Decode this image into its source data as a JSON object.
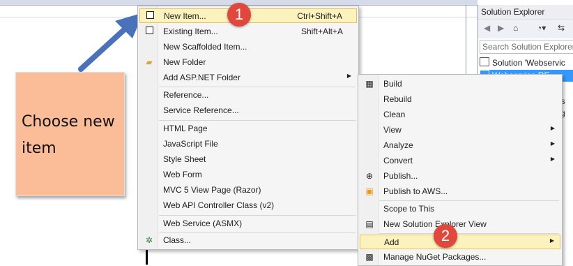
{
  "callout": {
    "text": "Choose new item"
  },
  "add_menu": {
    "items": [
      {
        "label": "New Item...",
        "shortcut": "Ctrl+Shift+A"
      },
      {
        "label": "Existing Item...",
        "shortcut": "Shift+Alt+A"
      },
      {
        "label": "New Scaffolded Item..."
      },
      {
        "label": "New Folder"
      },
      {
        "label": "Add ASP.NET Folder"
      },
      {
        "label": "Reference..."
      },
      {
        "label": "Service Reference..."
      },
      {
        "label": "HTML Page"
      },
      {
        "label": "JavaScript File"
      },
      {
        "label": "Style Sheet"
      },
      {
        "label": "Web Form"
      },
      {
        "label": "MVC 5 View Page (Razor)"
      },
      {
        "label": "Web API Controller Class (v2)"
      },
      {
        "label": "Web Service (ASMX)"
      },
      {
        "label": "Class..."
      }
    ]
  },
  "context_menu": {
    "items": [
      {
        "label": "Build"
      },
      {
        "label": "Rebuild"
      },
      {
        "label": "Clean"
      },
      {
        "label": "View"
      },
      {
        "label": "Analyze"
      },
      {
        "label": "Convert"
      },
      {
        "label": "Publish..."
      },
      {
        "label": "Publish to AWS..."
      },
      {
        "label": "Scope to This"
      },
      {
        "label": "New Solution Explorer View"
      },
      {
        "label": "Add"
      },
      {
        "label": "Manage NuGet Packages..."
      }
    ]
  },
  "badges": {
    "one": "1",
    "two": "2"
  },
  "solution_explorer": {
    "title": "Solution Explorer",
    "search_placeholder": "Search Solution Explorer",
    "rows": [
      "Solution 'Webservic",
      "Webservice.RE",
      "s",
      "es",
      "fig"
    ]
  },
  "colors": {
    "highlight": "#fcf2be",
    "badge": "#e0483e",
    "callout": "#fbbc98",
    "arrow": "#4a72b8"
  }
}
